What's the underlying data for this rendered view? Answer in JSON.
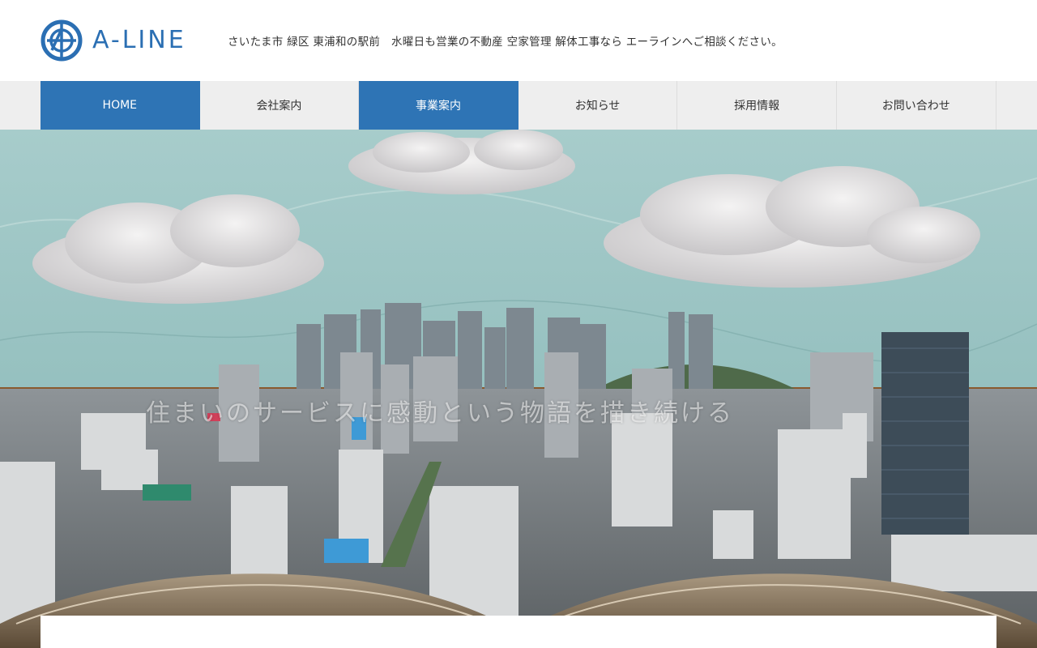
{
  "header": {
    "brand": "A-LINE",
    "tagline": "さいたま市 緑区 東浦和の駅前　水曜日も営業の不動産 空家管理 解体工事なら エーラインへご相談ください。"
  },
  "nav": {
    "items": [
      {
        "label": "HOME",
        "active": true
      },
      {
        "label": "会社案内",
        "active": false
      },
      {
        "label": "事業案内",
        "active": true
      },
      {
        "label": "お知らせ",
        "active": false
      },
      {
        "label": "採用情報",
        "active": false
      },
      {
        "label": "お問い合わせ",
        "active": false
      }
    ]
  },
  "hero": {
    "caption": "住まいのサービスに感動という物語を描き続ける"
  },
  "colors": {
    "brand": "#2b6fb3",
    "nav_active": "#2e74b5",
    "nav_bg": "#eeeeee",
    "sky": "#9fc7c6"
  }
}
